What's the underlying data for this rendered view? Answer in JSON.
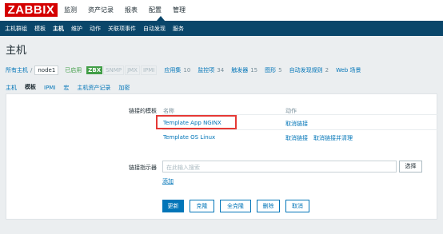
{
  "logo": "ZABBIX",
  "top_menu": [
    "监测",
    "资产记录",
    "报表",
    "配置",
    "管理"
  ],
  "sub_menu": [
    "主机群组",
    "模板",
    "主机",
    "维护",
    "动作",
    "关联项事件",
    "自动发现",
    "服务"
  ],
  "page_title": "主机",
  "breadcrumb": {
    "all_hosts": "所有主机",
    "separator": "/",
    "current": "node1",
    "status": "已启用",
    "zbx": "ZBX",
    "snmp": "SNMP",
    "jmx": "JMX",
    "ipmi": "IPMI",
    "items": [
      {
        "label": "应用集",
        "count": "10"
      },
      {
        "label": "监控项",
        "count": "34"
      },
      {
        "label": "触发器",
        "count": "15"
      },
      {
        "label": "图形",
        "count": "5"
      },
      {
        "label": "自动发现规则",
        "count": "2"
      },
      {
        "label": "Web 场景",
        "count": ""
      }
    ]
  },
  "tabs": [
    "主机",
    "模板",
    "IPMI",
    "宏",
    "主机资产记录",
    "加密"
  ],
  "form": {
    "linked_label": "链接的模板",
    "col_name": "名称",
    "col_action": "动作",
    "rows": [
      {
        "name": "Template App NGINX",
        "unlink": "取消链接",
        "unlink_clear": ""
      },
      {
        "name": "Template OS Linux",
        "unlink": "取消链接",
        "unlink_clear": "取消链接并清理"
      }
    ],
    "link_indicator_label": "链接指示器",
    "search_placeholder": "在此输入搜索",
    "select_btn": "选择",
    "add_link": "添加"
  },
  "buttons": {
    "update": "更新",
    "clone": "克隆",
    "full_clone": "全克隆",
    "delete": "删除",
    "cancel": "取消"
  },
  "colors": {
    "brand": "#d40000",
    "nav": "#0a466a",
    "link": "#0275b8",
    "enabled": "#429e47",
    "highlight": "#e53935"
  }
}
